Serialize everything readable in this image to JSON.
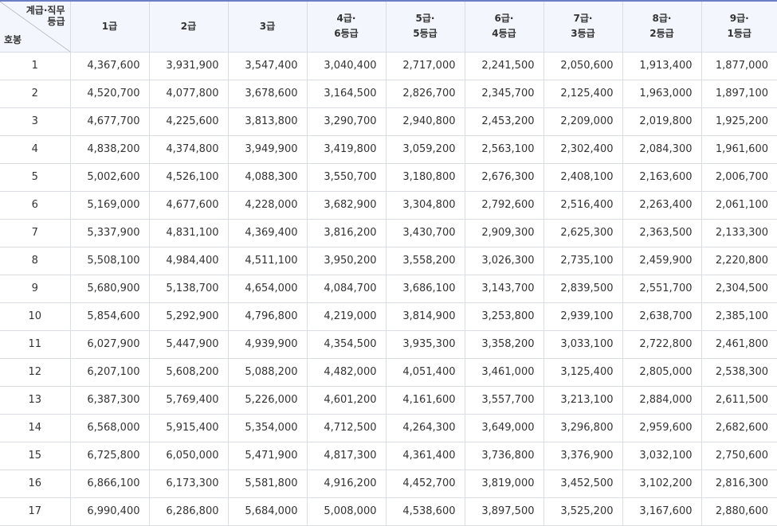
{
  "header": {
    "corner_top_lines": [
      "계급·직무",
      "등급"
    ],
    "corner_bottom": "호봉",
    "columns": [
      [
        "1급"
      ],
      [
        "2급"
      ],
      [
        "3급"
      ],
      [
        "4급·",
        "6등급"
      ],
      [
        "5급·",
        "5등급"
      ],
      [
        "6급·",
        "4등급"
      ],
      [
        "7급·",
        "3등급"
      ],
      [
        "8급·",
        "2등급"
      ],
      [
        "9급·",
        "1등급"
      ]
    ]
  },
  "rows": [
    {
      "hobong": "1",
      "values": [
        "4,367,600",
        "3,931,900",
        "3,547,400",
        "3,040,400",
        "2,717,000",
        "2,241,500",
        "2,050,600",
        "1,913,400",
        "1,877,000"
      ]
    },
    {
      "hobong": "2",
      "values": [
        "4,520,700",
        "4,077,800",
        "3,678,600",
        "3,164,500",
        "2,826,700",
        "2,345,700",
        "2,125,400",
        "1,963,000",
        "1,897,100"
      ]
    },
    {
      "hobong": "3",
      "values": [
        "4,677,700",
        "4,225,600",
        "3,813,800",
        "3,290,700",
        "2,940,800",
        "2,453,200",
        "2,209,000",
        "2,019,800",
        "1,925,200"
      ]
    },
    {
      "hobong": "4",
      "values": [
        "4,838,200",
        "4,374,800",
        "3,949,900",
        "3,419,800",
        "3,059,200",
        "2,563,100",
        "2,302,400",
        "2,084,300",
        "1,961,600"
      ]
    },
    {
      "hobong": "5",
      "values": [
        "5,002,600",
        "4,526,100",
        "4,088,300",
        "3,550,700",
        "3,180,800",
        "2,676,300",
        "2,408,100",
        "2,163,600",
        "2,006,700"
      ]
    },
    {
      "hobong": "6",
      "values": [
        "5,169,000",
        "4,677,600",
        "4,228,000",
        "3,682,900",
        "3,304,800",
        "2,792,600",
        "2,516,400",
        "2,263,400",
        "2,061,100"
      ]
    },
    {
      "hobong": "7",
      "values": [
        "5,337,900",
        "4,831,100",
        "4,369,400",
        "3,816,200",
        "3,430,700",
        "2,909,300",
        "2,625,300",
        "2,363,500",
        "2,133,300"
      ]
    },
    {
      "hobong": "8",
      "values": [
        "5,508,100",
        "4,984,400",
        "4,511,100",
        "3,950,200",
        "3,558,200",
        "3,026,300",
        "2,735,100",
        "2,459,900",
        "2,220,800"
      ]
    },
    {
      "hobong": "9",
      "values": [
        "5,680,900",
        "5,138,700",
        "4,654,000",
        "4,084,700",
        "3,686,100",
        "3,143,700",
        "2,839,500",
        "2,551,700",
        "2,304,500"
      ]
    },
    {
      "hobong": "10",
      "values": [
        "5,854,600",
        "5,292,900",
        "4,796,800",
        "4,219,000",
        "3,814,900",
        "3,253,800",
        "2,939,100",
        "2,638,700",
        "2,385,100"
      ]
    },
    {
      "hobong": "11",
      "values": [
        "6,027,900",
        "5,447,900",
        "4,939,900",
        "4,354,500",
        "3,935,300",
        "3,358,200",
        "3,033,100",
        "2,722,800",
        "2,461,800"
      ]
    },
    {
      "hobong": "12",
      "values": [
        "6,207,100",
        "5,608,200",
        "5,088,200",
        "4,482,000",
        "4,051,400",
        "3,461,000",
        "3,125,400",
        "2,805,000",
        "2,538,300"
      ]
    },
    {
      "hobong": "13",
      "values": [
        "6,387,300",
        "5,769,400",
        "5,226,000",
        "4,601,200",
        "4,161,600",
        "3,557,700",
        "3,213,100",
        "2,884,000",
        "2,611,500"
      ]
    },
    {
      "hobong": "14",
      "values": [
        "6,568,000",
        "5,915,400",
        "5,354,000",
        "4,712,500",
        "4,264,300",
        "3,649,000",
        "3,296,800",
        "2,959,600",
        "2,682,600"
      ]
    },
    {
      "hobong": "15",
      "values": [
        "6,725,800",
        "6,050,000",
        "5,471,900",
        "4,817,300",
        "4,361,400",
        "3,736,800",
        "3,376,900",
        "3,032,100",
        "2,750,600"
      ]
    },
    {
      "hobong": "16",
      "values": [
        "6,866,100",
        "6,173,300",
        "5,581,800",
        "4,916,200",
        "4,452,700",
        "3,819,000",
        "3,452,500",
        "3,102,200",
        "2,816,300"
      ]
    },
    {
      "hobong": "17",
      "values": [
        "6,990,400",
        "6,286,800",
        "5,684,000",
        "5,008,000",
        "4,538,600",
        "3,897,500",
        "3,525,200",
        "3,167,600",
        "2,880,600"
      ]
    }
  ]
}
